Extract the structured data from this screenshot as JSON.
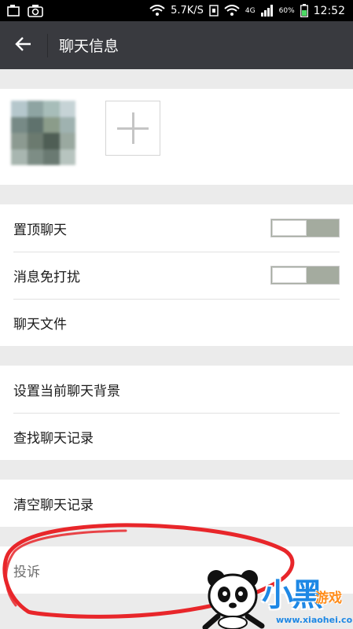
{
  "status_bar": {
    "network_speed": "5.7K/S",
    "signal_type": "4G",
    "battery": "60%",
    "time": "12:52"
  },
  "header": {
    "title": "聊天信息"
  },
  "groups": [
    {
      "rows": [
        {
          "label": "置顶聊天",
          "toggle": true,
          "enabled": false
        },
        {
          "label": "消息免打扰",
          "toggle": true,
          "enabled": false
        },
        {
          "label": "聊天文件",
          "toggle": false
        }
      ]
    },
    {
      "rows": [
        {
          "label": "设置当前聊天背景"
        },
        {
          "label": "查找聊天记录"
        }
      ]
    },
    {
      "rows": [
        {
          "label": "清空聊天记录"
        }
      ]
    },
    {
      "rows": [
        {
          "label": "投诉"
        }
      ]
    }
  ],
  "watermark": {
    "brand": "小黑",
    "games": "游戏",
    "url": "www.xiaohei.com"
  },
  "colors": {
    "action_bar": "#393a3f",
    "page_background": "#ebebeb",
    "annotation_red": "#e8262a",
    "toggle_track": "#a4ab9f"
  }
}
